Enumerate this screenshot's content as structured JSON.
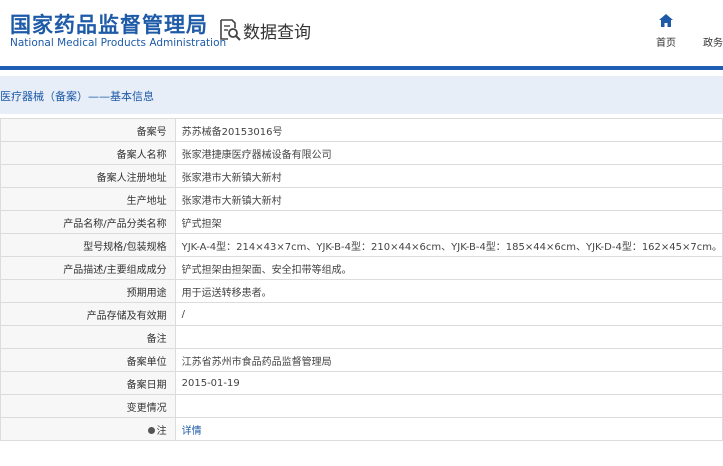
{
  "header": {
    "org_name_cn": "国家药品监督管理局",
    "org_name_en": "National Medical Products Administration",
    "query_title": "数据查询"
  },
  "nav": {
    "home_label": "首页",
    "policy_label": "政务"
  },
  "section": {
    "title": "医疗器械（备案）——基本信息"
  },
  "rows": [
    {
      "label": "备案号",
      "value": "苏苏械备20153016号"
    },
    {
      "label": "备案人名称",
      "value": "张家港捷康医疗器械设备有限公司"
    },
    {
      "label": "备案人注册地址",
      "value": "张家港市大新镇大新村"
    },
    {
      "label": "生产地址",
      "value": "张家港市大新镇大新村"
    },
    {
      "label": "产品名称/产品分类名称",
      "value": "铲式担架"
    },
    {
      "label": "型号规格/包装规格",
      "value": "YJK-A-4型：214×43×7cm、YJK-B-4型：210×44×6cm、YJK-B-4型：185×44×6cm、YJK-D-4型：162×45×7cm。"
    },
    {
      "label": "产品描述/主要组成成分",
      "value": "铲式担架由担架面、安全扣带等组成。"
    },
    {
      "label": "预期用途",
      "value": "用于运送转移患者。"
    },
    {
      "label": "产品存储及有效期",
      "value": "/"
    },
    {
      "label": "备注",
      "value": ""
    },
    {
      "label": "备案单位",
      "value": "江苏省苏州市食品药品监督管理局"
    },
    {
      "label": "备案日期",
      "value": "2015-01-19"
    },
    {
      "label": "变更情况",
      "value": ""
    }
  ],
  "note_row": {
    "label": "注",
    "link_text": "详情"
  },
  "colors": {
    "brand_blue": "#1d5aa8",
    "bar_blue": "#1e5fb5",
    "band_bg": "#e8eef7"
  },
  "icons": {
    "query": "document-search-icon",
    "home": "home-icon",
    "note": "pin-icon"
  }
}
